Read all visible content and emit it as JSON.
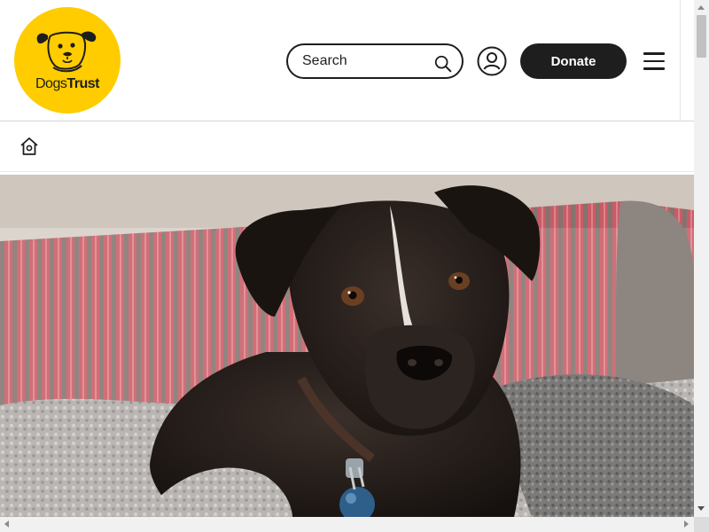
{
  "header": {
    "logo": {
      "name_part1": "Dogs",
      "name_part2": "Trust",
      "icon": "dog-face-icon",
      "color": "#ffcc00"
    },
    "search": {
      "placeholder": "Search",
      "icon": "search-icon"
    },
    "account": {
      "icon": "account-icon"
    },
    "donate_label": "Donate",
    "menu": {
      "icon": "hamburger-menu-icon"
    }
  },
  "breadcrumb": {
    "home_icon": "home-icon"
  },
  "hero": {
    "image": "black-dog-lying-on-blanket"
  },
  "colors": {
    "brand_yellow": "#ffcc00",
    "ink": "#1e1e1e",
    "background": "#ffffff"
  }
}
